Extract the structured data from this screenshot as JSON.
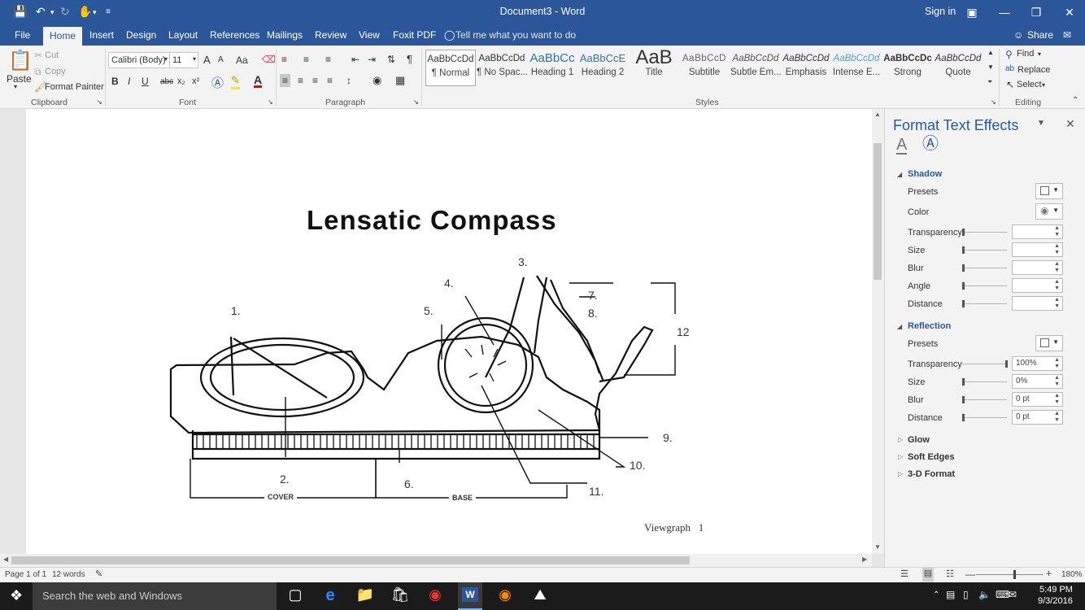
{
  "title_bar": {
    "document_title": "Document3 - Word",
    "sign_in": "Sign in"
  },
  "tabs": [
    "File",
    "Home",
    "Insert",
    "Design",
    "Layout",
    "References",
    "Mailings",
    "Review",
    "View",
    "Foxit PDF"
  ],
  "tell_me": "Tell me what you want to do",
  "share": "Share",
  "clipboard": {
    "paste": "Paste",
    "cut": "Cut",
    "copy": "Copy",
    "format_painter": "Format Painter",
    "label": "Clipboard"
  },
  "font": {
    "name": "Calibri (Body)",
    "size": "11",
    "label": "Font",
    "bold": "B",
    "italic": "I",
    "underline": "U",
    "strike": "abc",
    "sub": "x₂",
    "sup": "x²",
    "grow": "A",
    "shrink": "A",
    "case": "Aa"
  },
  "paragraph": {
    "label": "Paragraph"
  },
  "styles": {
    "label": "Styles",
    "items": [
      {
        "preview": "AaBbCcDd",
        "name": "¶ Normal"
      },
      {
        "preview": "AaBbCcDd",
        "name": "¶ No Spac..."
      },
      {
        "preview": "AaBbCc",
        "name": "Heading 1"
      },
      {
        "preview": "AaBbCcE",
        "name": "Heading 2"
      },
      {
        "preview": "AaB",
        "name": "Title"
      },
      {
        "preview": "AaBbCcD",
        "name": "Subtitle"
      },
      {
        "preview": "AaBbCcDd",
        "name": "Subtle Em..."
      },
      {
        "preview": "AaBbCcDd",
        "name": "Emphasis"
      },
      {
        "preview": "AaBbCcDd",
        "name": "Intense E..."
      },
      {
        "preview": "AaBbCcDc",
        "name": "Strong"
      },
      {
        "preview": "AaBbCcDd",
        "name": "Quote"
      }
    ]
  },
  "editing": {
    "find": "Find",
    "replace": "Replace",
    "select": "Select",
    "label": "Editing"
  },
  "document": {
    "heading": "Lensatic Compass",
    "callouts": [
      "1.",
      "2.",
      "3.",
      "4.",
      "5.",
      "6.",
      "7.",
      "8.",
      "9.",
      "10.",
      "11.",
      "12"
    ],
    "cover": "COVER",
    "base": "BASE",
    "caption": "Viewgraph   1"
  },
  "pane": {
    "title": "Format Text Effects",
    "shadow": {
      "header": "Shadow",
      "presets": "Presets",
      "color": "Color",
      "transparency": "Transparency",
      "size": "Size",
      "blur": "Blur",
      "angle": "Angle",
      "distance": "Distance"
    },
    "reflection": {
      "header": "Reflection",
      "presets": "Presets",
      "transparency": "Transparency",
      "transparency_value": "100%",
      "size": "Size",
      "size_value": "0%",
      "blur": "Blur",
      "blur_value": "0 pt",
      "distance": "Distance",
      "distance_value": "0 pt"
    },
    "glow": "Glow",
    "soft_edges": "Soft Edges",
    "format_3d": "3-D Format"
  },
  "status": {
    "page": "Page 1 of 1",
    "words": "12 words",
    "zoom": "180%"
  },
  "taskbar": {
    "search": "Search the web and Windows",
    "time": "5:49 PM",
    "date": "9/3/2016"
  }
}
